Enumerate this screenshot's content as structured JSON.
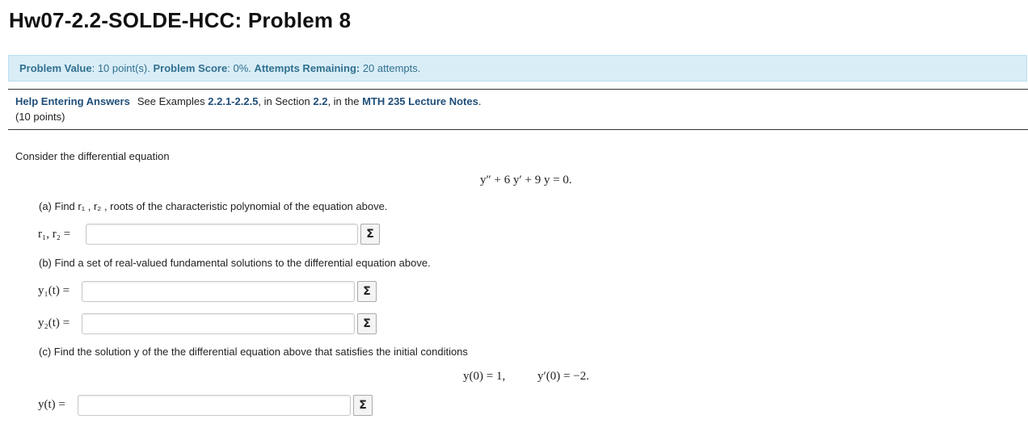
{
  "title": "Hw07-2.2-SOLDE-HCC: Problem 8",
  "info": {
    "value_label": "Problem Value",
    "value_text": ": 10 point(s). ",
    "score_label": "Problem Score",
    "score_text": ": 0%. ",
    "attempts_label": "Attempts Remaining:",
    "attempts_text": " 20 attempts."
  },
  "help": {
    "link": "Help Entering Answers",
    "text1": "See Examples ",
    "examples": "2.2.1-2.2.5",
    "text2": ", in Section ",
    "section": "2.2",
    "text3": ", in the ",
    "notes": "MTH 235 Lecture Notes",
    "text4": "."
  },
  "points": "(10 points)",
  "problem": {
    "intro": "Consider the differential equation",
    "equation": "y″ + 6 y′ + 9 y = 0.",
    "part_a": "(a) Find r₁ , r₂ , roots of the characteristic polynomial of the equation above.",
    "label_a": "r₁, r₂ =",
    "part_b": "(b) Find a set of real-valued fundamental solutions to the differential equation above.",
    "label_b1": "y₁(t) =",
    "label_b2": "y₂(t) =",
    "part_c": "(c) Find the solution y of the the differential equation above that satisfies the initial conditions",
    "ic1": "y(0) = 1,",
    "ic2": "y′(0) = −2.",
    "label_c": "y(t) ="
  },
  "sigma_label": "Σ",
  "icons": [
    "sigma-icon"
  ]
}
